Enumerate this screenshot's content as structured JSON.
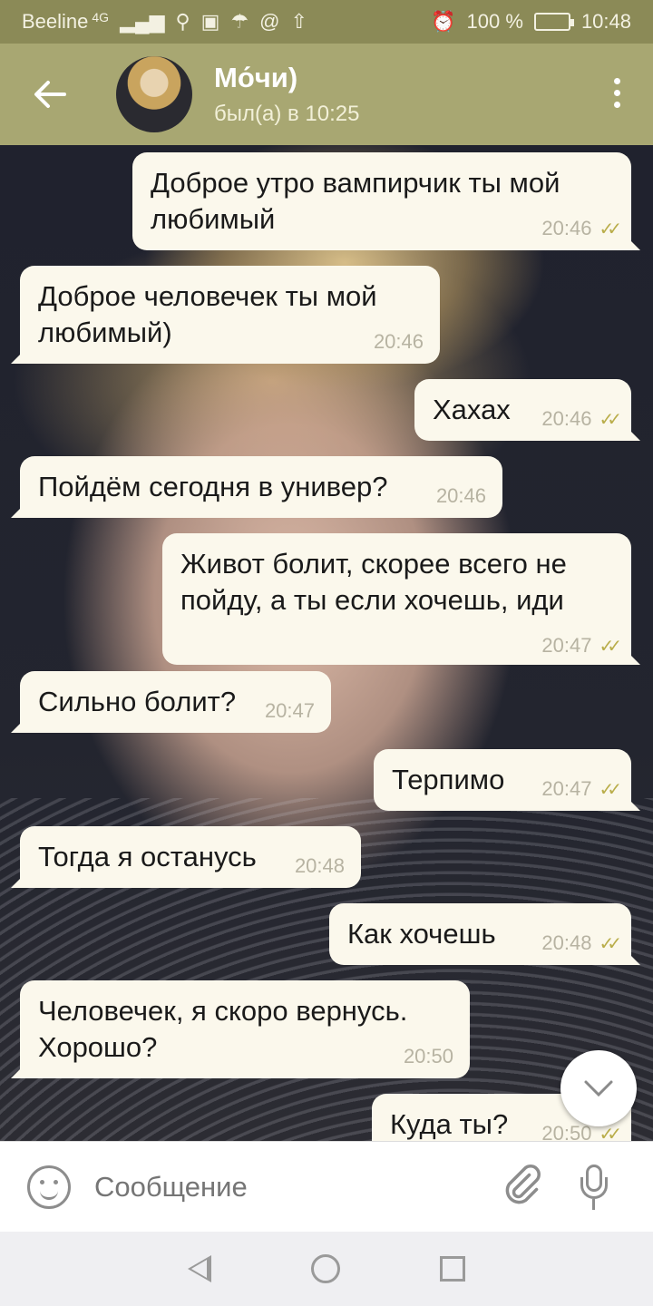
{
  "status_bar": {
    "carrier": "Beeline",
    "network": "4G",
    "battery": "100 %",
    "time": "10:48"
  },
  "header": {
    "contact_name": "Мо́чи)",
    "last_seen": "был(а) в 10:25"
  },
  "messages": [
    {
      "dir": "out",
      "text": "Доброе утро вампирчик ты мой любимый",
      "time": "20:46",
      "read": true
    },
    {
      "dir": "in",
      "text": "Доброе человечек ты мой любимый)",
      "time": "20:46"
    },
    {
      "dir": "out",
      "text": "Хахах",
      "time": "20:46",
      "read": true
    },
    {
      "dir": "in",
      "text": "Пойдём сегодня в универ?",
      "time": "20:46"
    },
    {
      "dir": "out",
      "text": "Живот болит, скорее всего не пойду, а ты если хочешь, иди",
      "time": "20:47",
      "read": true
    },
    {
      "dir": "in",
      "text": "Сильно болит?",
      "time": "20:47"
    },
    {
      "dir": "out",
      "text": "Терпимо",
      "time": "20:47",
      "read": true
    },
    {
      "dir": "in",
      "text": "Тогда я останусь",
      "time": "20:48"
    },
    {
      "dir": "out",
      "text": "Как хочешь",
      "time": "20:48",
      "read": true
    },
    {
      "dir": "in",
      "text": "Человечек, я скоро вернусь. Хорошо?",
      "time": "20:50"
    },
    {
      "dir": "out",
      "text": "Куда ты?",
      "time": "20:50",
      "read": true
    }
  ],
  "input": {
    "placeholder": "Сообщение"
  },
  "icons": {
    "back": "arrow-left-icon",
    "menu": "more-vert-icon",
    "scroll_down": "chevron-down-icon",
    "emoji": "emoji-icon",
    "attach": "paperclip-icon",
    "mic": "microphone-icon"
  },
  "colors": {
    "header": "#a8a772",
    "status_bar": "#8b8a57",
    "bubble": "#fbf8ec",
    "read_ticks": "#b9ad4a"
  }
}
